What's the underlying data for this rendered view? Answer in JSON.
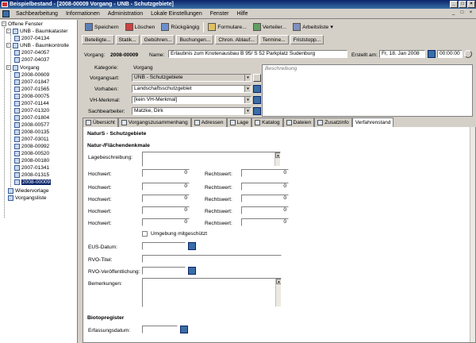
{
  "window": {
    "title": "Beispielbestand - [2008-00009 Vorgang - UNB - Schutzgebiete]",
    "btn_min": "_",
    "btn_max": "□",
    "btn_close": "×"
  },
  "menu": {
    "items": [
      "Sachbearbeitung",
      "Informationen",
      "Administration",
      "Lokale Einstellungen",
      "Fenster",
      "Hilfe"
    ],
    "mdi_min": "_",
    "mdi_max": "□",
    "mdi_close": "×"
  },
  "sidebar": {
    "root": "Offene Fenster",
    "groups": [
      {
        "label": "UNB - Baumkataster",
        "items": [
          "2007-04134"
        ]
      },
      {
        "label": "UNB - Baumkontrolle",
        "items": [
          "2007-04057",
          "2007-04037"
        ]
      },
      {
        "label": "Vorgang",
        "items": [
          "2008-00609",
          "2007-01847",
          "2007-01565",
          "2008-00075",
          "2007-01144",
          "2007-01320",
          "2007-01804",
          "2008-00577",
          "2008-00135",
          "2007-03011",
          "2008-00992",
          "2008-00520",
          "2008-00180",
          "2007-01341",
          "2008-01315",
          "2008-00009"
        ]
      }
    ],
    "extra": [
      "Wiedervorlage",
      "Vorgangsliste"
    ],
    "expand_minus": "−"
  },
  "toolbar": {
    "buttons": [
      "Speichern",
      "Löschen",
      "Rückgängig",
      "Formulare...",
      "Verteiler...",
      "Arbeitsliste"
    ],
    "dropdown": "▾"
  },
  "subtabs": [
    "Beteiligte...",
    "Statik...",
    "Gebühren...",
    "Buchungen...",
    "Chron. Ablauf...",
    "Termine...",
    "Fristst​opp..."
  ],
  "vorgang": {
    "label": "Vorgang:",
    "number": "2008-00009",
    "name_label": "Name:",
    "name_value": "Erlaubnis zum Knotenausbau B 95/ S 52 Parkplatz Sudenburg",
    "erstellt_label": "Erstellt am:",
    "erstellt_date": "Fr, 18. Jan 2008",
    "erstellt_time": "00:00:00"
  },
  "form": {
    "kategorie_label": "Kategorie:",
    "kategorie_value": "Vorgang",
    "vorgangsart_label": "Vorgangsart:",
    "vorgangsart_value": "UNB - Schutzgebiete",
    "vorhaben_label": "Vorhaben:",
    "vorhaben_value": "Landschaftsschutzgebiet",
    "vhmerkmal_label": "VH-Merkmal:",
    "vhmerkmal_value": "[kein VH-Merkmal]",
    "sachbearbeiter_label": "Sachbearbeiter:",
    "sachbearbeiter_value": "Matzke, Dirk",
    "beschreibung_placeholder": "Beschreibung",
    "combo_arrow": "▾"
  },
  "tabs": [
    "Übersicht",
    "Vorgangszusammenhang",
    "Adressen",
    "Lage",
    "Katalog",
    "Dateien",
    "Zusatzinfo",
    "Verfahrenstand"
  ],
  "detail": {
    "heading": "NaturS - Schutzgebiete",
    "section1": "Natur-/Flächendenkmale",
    "lagebeschreibung_label": "Lagebeschreibung:",
    "hochwert_label": "Hochwert:",
    "rechtswert_label": "Rechtswert:",
    "zero": "0",
    "umgebung_label": "Umgebung mitgeschützt",
    "eus_label": "EUS-Datum:",
    "rvo_titel_label": "RVO-Titel:",
    "rvo_ver_label": "RVO-Veröffentlichung:",
    "bemerkungen_label": "Bemerkungen:",
    "section2": "Biotopregister",
    "erfassung_label": "Erfassungsdatum:",
    "scroll_up": "▲",
    "scroll_down": "▼"
  }
}
